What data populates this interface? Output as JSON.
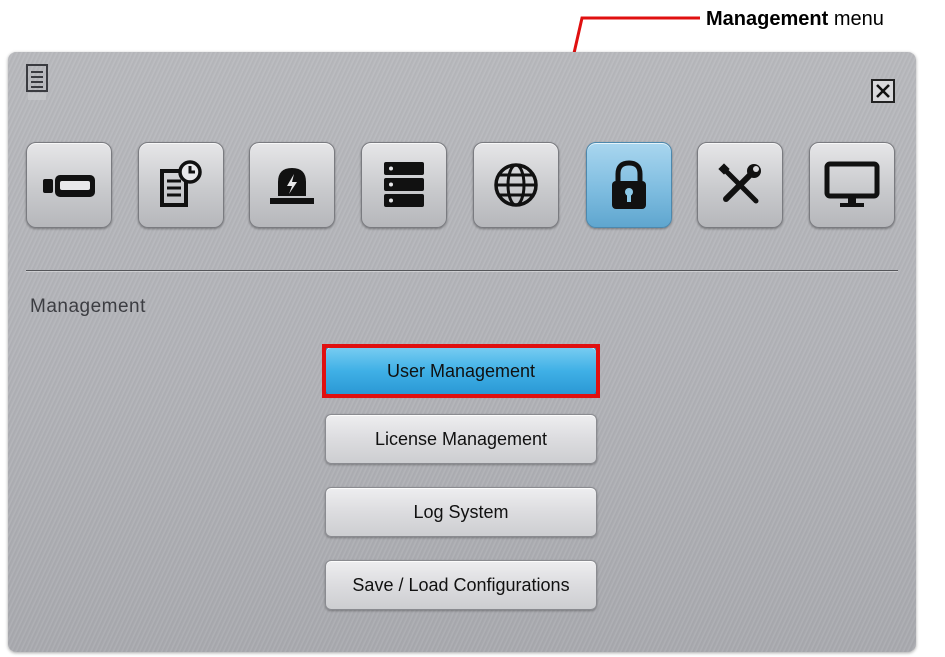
{
  "callout": {
    "bold_text": "Management",
    "text": "menu",
    "color": "#e01010"
  },
  "window": {
    "menu_icon": "document-menu-icon",
    "close_icon": "close-x-icon"
  },
  "tabs": [
    {
      "icon": "camera-icon",
      "active": false
    },
    {
      "icon": "schedule-document-icon",
      "active": false
    },
    {
      "icon": "alarm-siren-icon",
      "active": false
    },
    {
      "icon": "storage-server-icon",
      "active": false
    },
    {
      "icon": "network-globe-icon",
      "active": false
    },
    {
      "icon": "lock-icon",
      "active": true
    },
    {
      "icon": "tools-icon",
      "active": false
    },
    {
      "icon": "monitor-icon",
      "active": false
    }
  ],
  "section": {
    "title": "Management"
  },
  "buttons": [
    {
      "label": "User Management",
      "selected": true
    },
    {
      "label": "License Management",
      "selected": false
    },
    {
      "label": "Log System",
      "selected": false
    },
    {
      "label": "Save / Load Configurations",
      "selected": false
    }
  ],
  "colors": {
    "highlight": "#e01010",
    "active_blue": "#3fb0e6"
  }
}
